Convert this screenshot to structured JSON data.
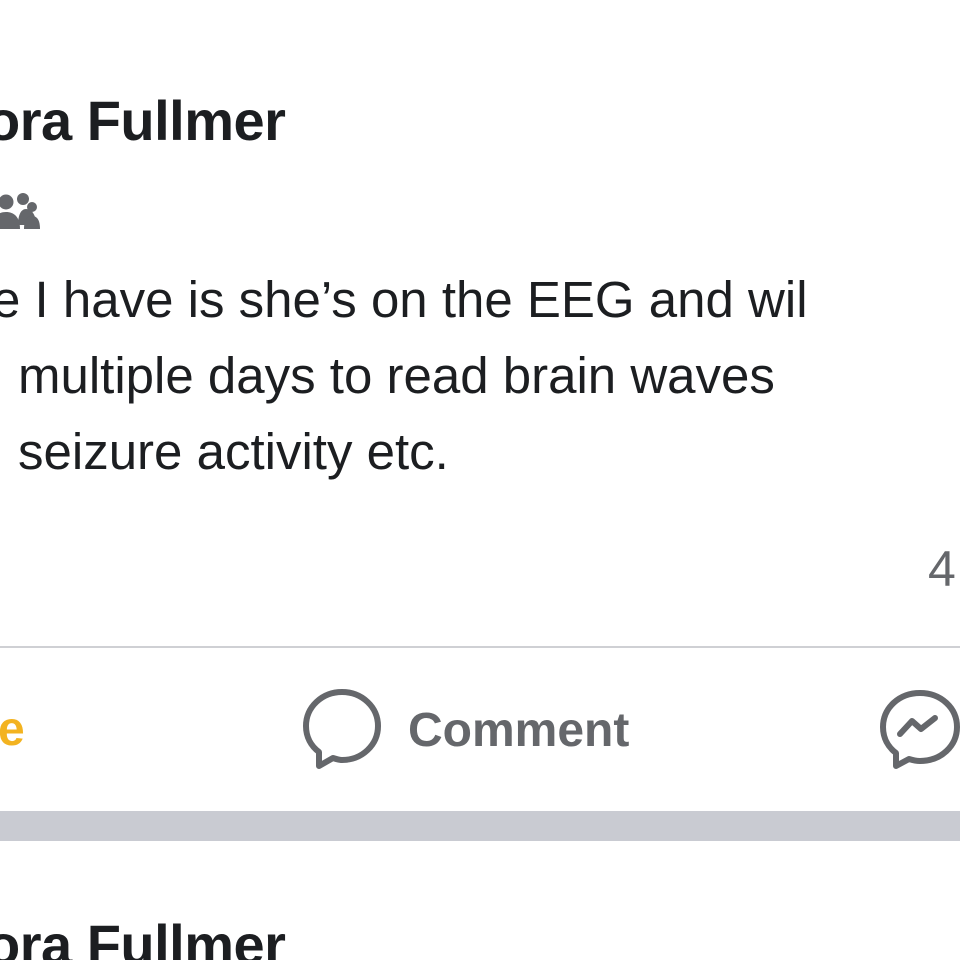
{
  "post": {
    "author": "ora Fullmer",
    "audience_icon": "friends-icon",
    "text_lines": [
      "e I have is she’s on the EEG and wil",
      "multiple days to read brain waves",
      "seizure activity etc."
    ],
    "reaction_count": "4"
  },
  "actions": {
    "like_label": "e",
    "comment_label": "Comment",
    "comment_icon": "comment-bubble-icon",
    "share_icon": "messenger-icon"
  },
  "next_post": {
    "author": "ora Fullmer"
  },
  "colors": {
    "text": "#1c1e21",
    "secondary_text": "#65676b",
    "like_active": "#f3b320",
    "divider": "#cfd0d4",
    "separator_band": "#c9cbd2"
  }
}
